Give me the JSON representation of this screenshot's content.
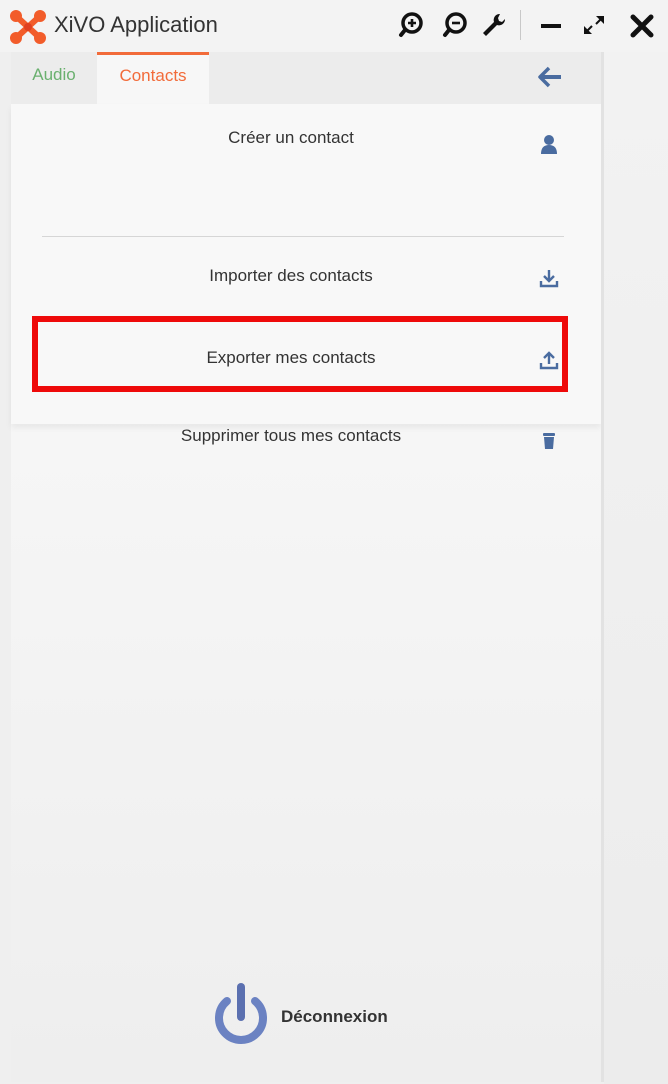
{
  "window": {
    "title": "XiVO Application",
    "controls": [
      "zoom-in-icon",
      "zoom-out-icon",
      "wrench-icon",
      "minimize-icon",
      "expand-icon",
      "close-icon"
    ]
  },
  "tabs": [
    {
      "label": "Audio",
      "color": "#6ab06f",
      "active": false
    },
    {
      "label": "Contacts",
      "color": "#f26b3a",
      "active": true
    }
  ],
  "menu": {
    "items": [
      {
        "label": "Créer un contact",
        "icon": "person-icon"
      },
      {
        "label": "Importer des contacts",
        "icon": "download-icon"
      },
      {
        "label": "Exporter mes contacts",
        "icon": "upload-icon",
        "highlighted": true
      },
      {
        "label": "Supprimer tous mes contacts",
        "icon": "trash-icon"
      }
    ]
  },
  "logout": {
    "label": "Déconnexion",
    "icon": "power-icon"
  },
  "colors": {
    "accent": "#f26b3a",
    "audio_tab": "#6ab06f",
    "icon_blue": "#4a6ca0",
    "highlight_border": "#ee0a0a"
  }
}
